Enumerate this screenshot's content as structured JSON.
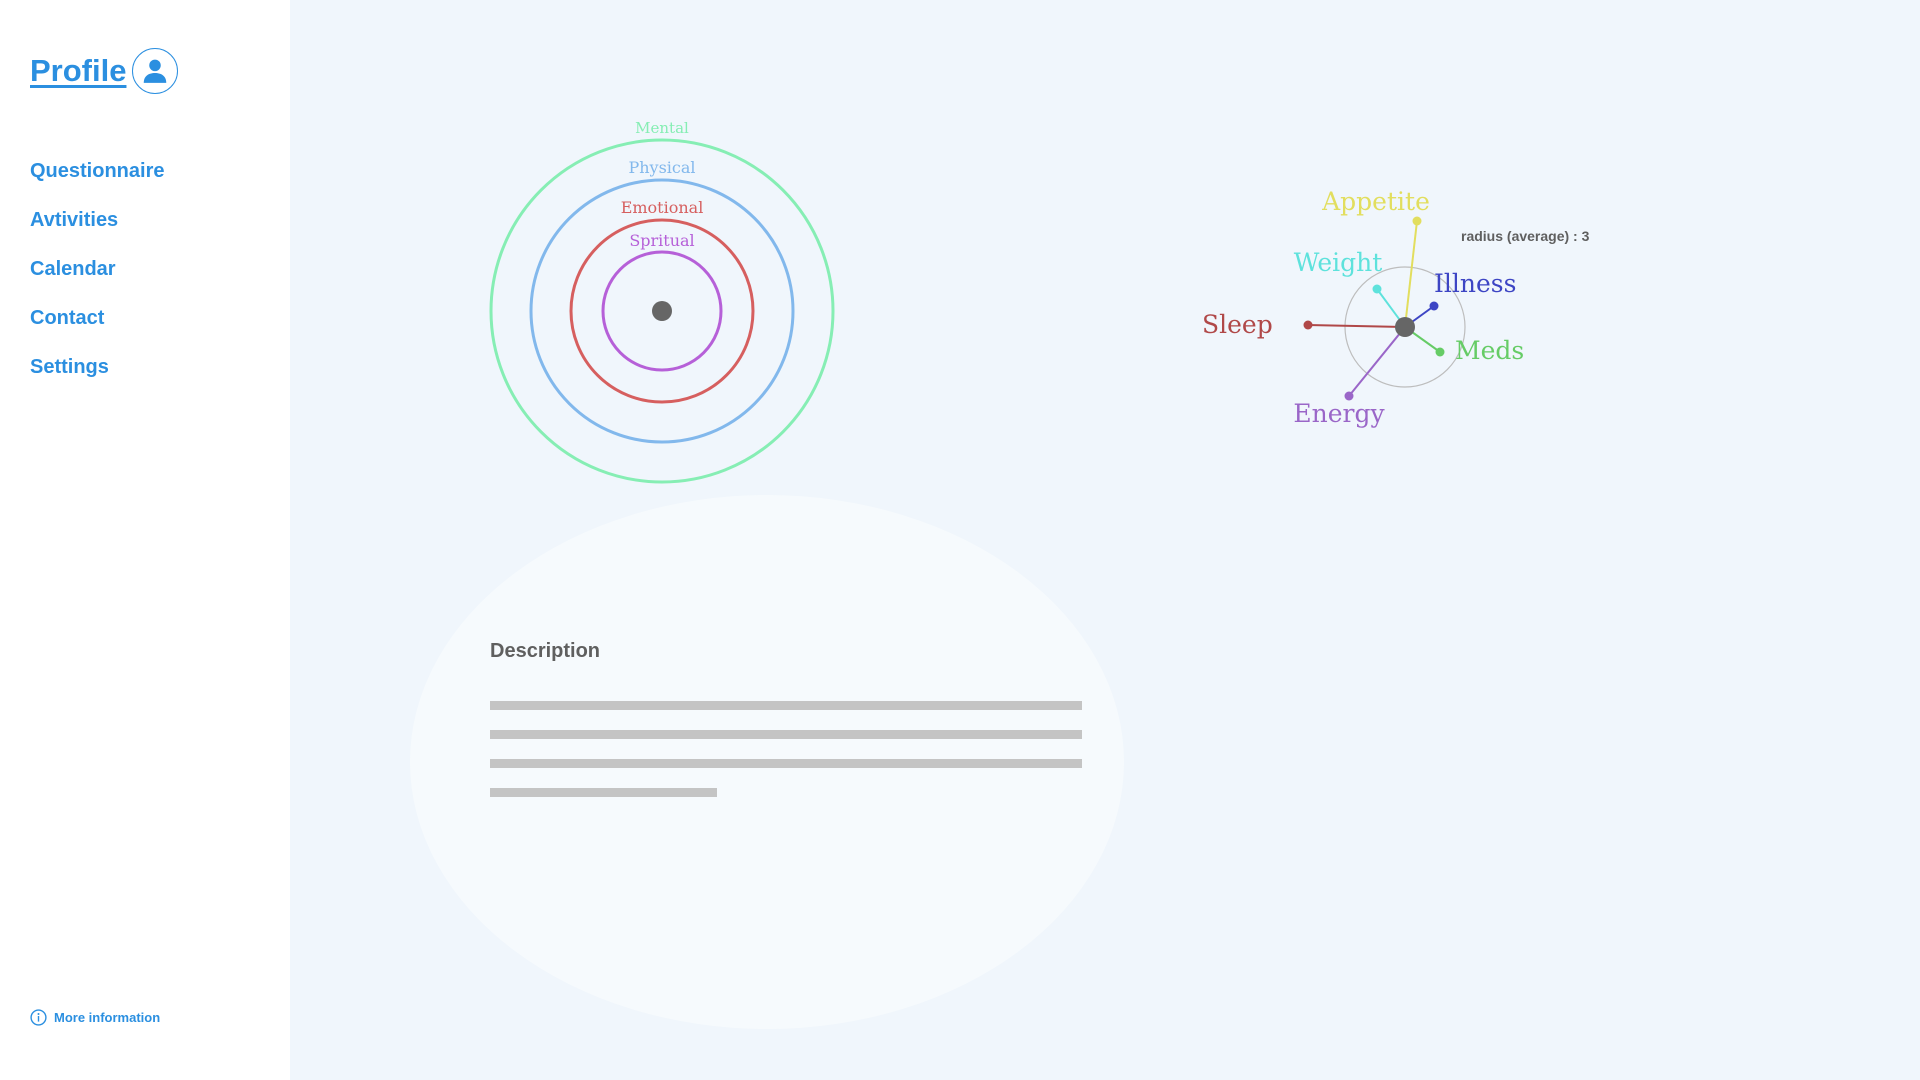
{
  "sidebar": {
    "profile_label": "Profile",
    "profile_icon": "user-icon",
    "nav_items": [
      {
        "label": "Questionnaire"
      },
      {
        "label": "Avtivities"
      },
      {
        "label": "Calendar"
      },
      {
        "label": "Contact"
      },
      {
        "label": "Settings"
      }
    ],
    "more_info_label": "More information",
    "more_info_icon": "info-icon"
  },
  "rings": {
    "items": [
      {
        "label": "Mental",
        "color": "#86eeb4"
      },
      {
        "label": "Physical",
        "color": "#82b8ec"
      },
      {
        "label": "Emotional",
        "color": "#d65f5f"
      },
      {
        "label": "Spritual",
        "color": "#b660d8"
      }
    ],
    "center_color": "#666666"
  },
  "radial": {
    "radius_label": "radius (average) : 3",
    "spokes": [
      {
        "label": "Appetite",
        "color": "#e2de5e"
      },
      {
        "label": "Illness",
        "color": "#3d45c4"
      },
      {
        "label": "Meds",
        "color": "#66cc66"
      },
      {
        "label": "Energy",
        "color": "#9a66c8"
      },
      {
        "label": "Sleep",
        "color": "#b04848"
      },
      {
        "label": "Weight",
        "color": "#5ee2dc"
      }
    ],
    "center_color": "#666666"
  },
  "description": {
    "title": "Description"
  }
}
